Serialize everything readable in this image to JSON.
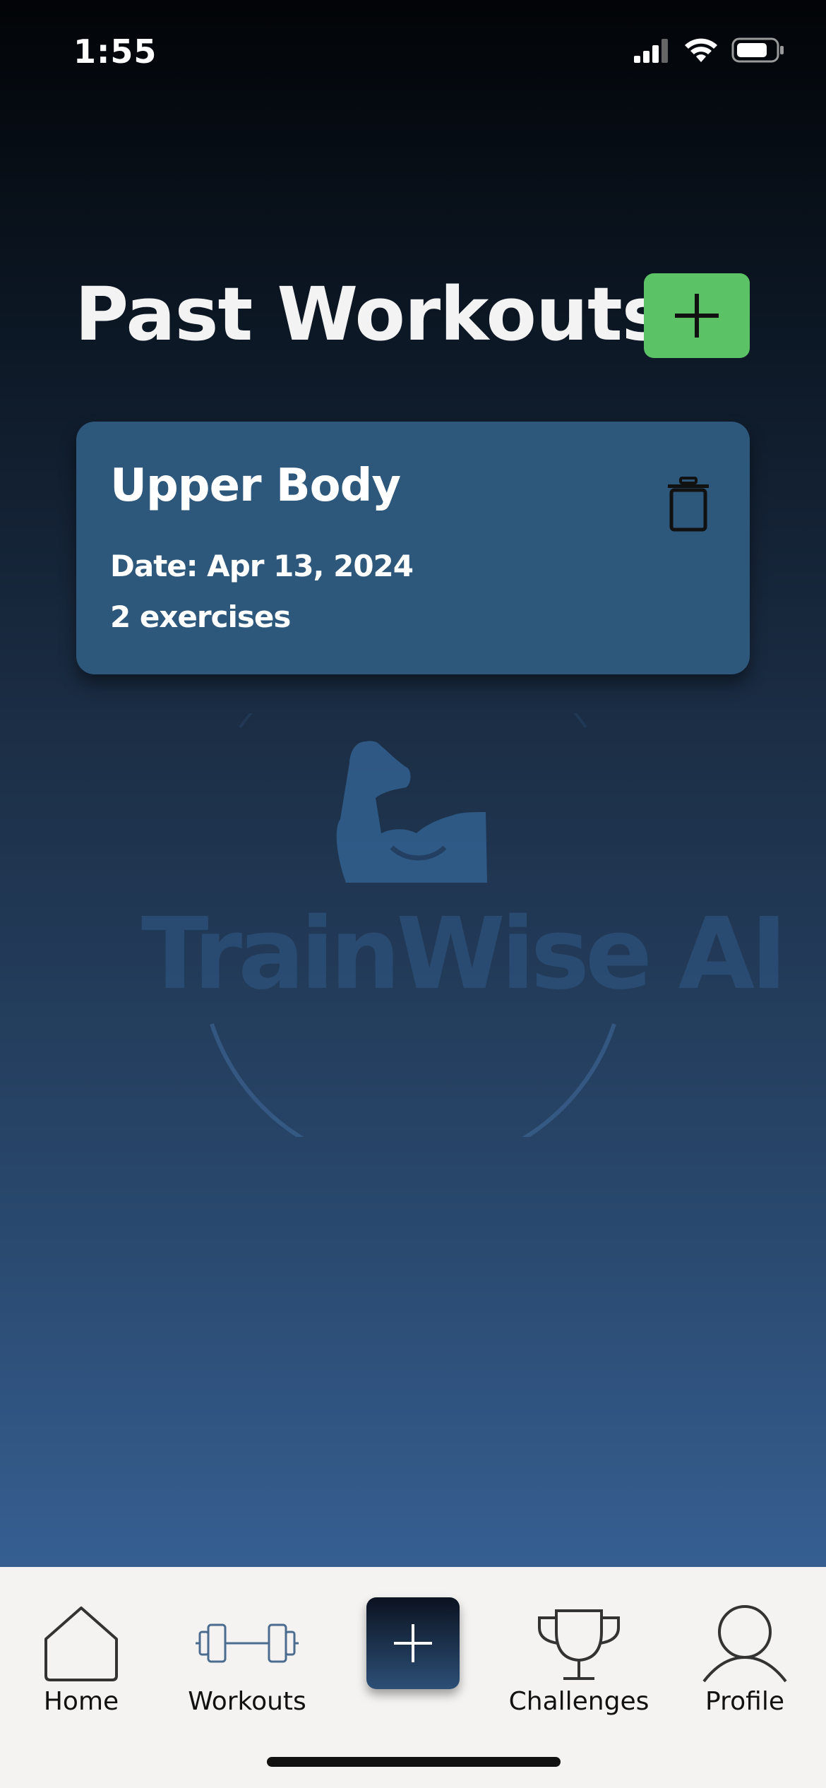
{
  "status_bar": {
    "time": "1:55"
  },
  "page": {
    "title": "Past Workouts"
  },
  "workouts": [
    {
      "name": "Upper Body",
      "date": "Date: Apr 13, 2024",
      "exercises": "2 exercises"
    }
  ],
  "watermark": {
    "text": "TrainWise AI"
  },
  "nav": {
    "home": "Home",
    "workouts": "Workouts",
    "challenges": "Challenges",
    "profile": "Profile"
  },
  "colors": {
    "accent_green": "#5bc265",
    "card_bg": "#2d587b",
    "nav_bg": "#f4f3f1"
  },
  "icons": [
    "signal-icon",
    "wifi-icon",
    "battery-icon",
    "plus-icon",
    "trash-icon",
    "flexed-arm-icon",
    "home-icon",
    "dumbbell-icon",
    "trophy-icon",
    "user-icon"
  ]
}
